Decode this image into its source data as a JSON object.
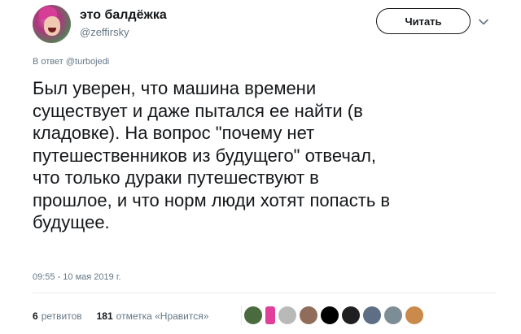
{
  "user": {
    "name": "это балдёжка",
    "handle": "@zeffirsky"
  },
  "follow_button": {
    "label": "Читать"
  },
  "reply_to": {
    "prefix": "В ответ",
    "mention": "@turbojedi"
  },
  "tweet": {
    "text": "Был уверен, что машина времени\nсуществует и даже пытался ее найти (в\nкладовке). На вопрос \"почему нет\nпутешественников из будущего\" отвечал,\nчто только дураки путешествуют в\nпрошлое, и что норм люди хотят попасть в\nбудущее.",
    "timestamp": "09:55 - 10 мая 2019 г."
  },
  "stats": {
    "retweets_count": "6",
    "retweets_label": "ретвитов",
    "likes_count": "181",
    "likes_label": "отметка «Нравится»"
  },
  "likers": [
    {
      "color": "#4a6b3e"
    },
    {
      "color": "#e0409a"
    },
    {
      "color": "#b9b9b9"
    },
    {
      "color": "#8f6d5a"
    },
    {
      "color": "#000000"
    },
    {
      "color": "#1f1f1f"
    },
    {
      "color": "#5e6f85"
    },
    {
      "color": "#7d8d96"
    },
    {
      "color": "#c98a4b"
    }
  ],
  "colors": {
    "text": "#14171a",
    "muted": "#657786",
    "divider": "#e6ecf0"
  }
}
